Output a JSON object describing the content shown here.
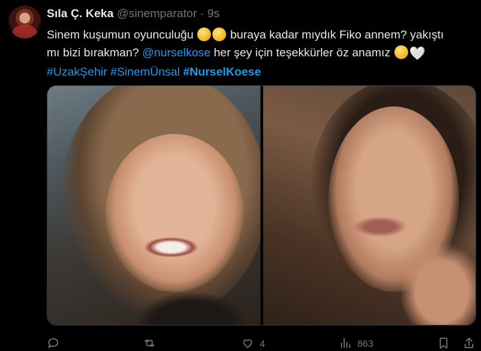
{
  "tweet": {
    "author_name": "Sıla Ç. Keka",
    "author_handle": "@sinemparator",
    "separator": "·",
    "timestamp": "9s",
    "text": {
      "line1_before_emoji": "Sinem kuşumun oyunculuğu",
      "line1_after_emoji": " buraya kadar mıydık Fiko annem? yakıştı",
      "line2_start": "mı bizi bırakman? ",
      "mention": "@nurselkose",
      "line2_rest": " her şey için teşekkürler öz anamız ",
      "hashtags": [
        "#UzakŞehir",
        "#SinemÜnsal",
        "#NurselKoese"
      ]
    },
    "emoji": {
      "heart": "🤍"
    },
    "stats": {
      "likes": "4",
      "views": "863"
    },
    "icons": [
      "reply-icon",
      "retweet-icon",
      "heart-icon",
      "views-icon",
      "bookmark-icon",
      "share-icon"
    ]
  },
  "colors": {
    "background": "#000000",
    "text": "#e7e9ea",
    "muted": "#71767b",
    "link": "#1d9bf0"
  }
}
